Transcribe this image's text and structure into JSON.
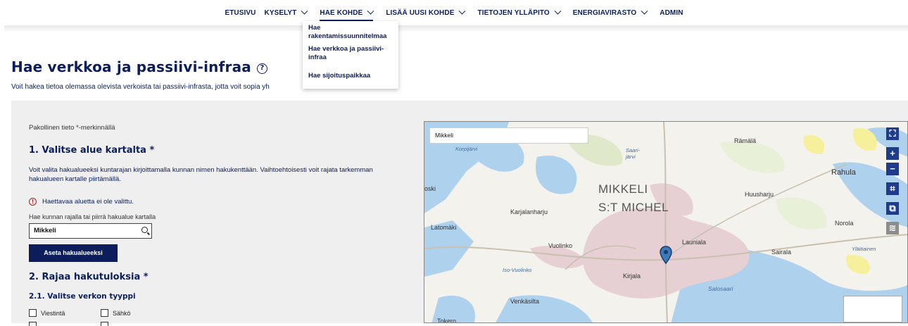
{
  "nav": {
    "items": [
      {
        "label": "ETUSIVU",
        "dropdown": false
      },
      {
        "label": "KYSELYT",
        "dropdown": true
      },
      {
        "label": "HAE KOHDE",
        "dropdown": true,
        "active": true
      },
      {
        "label": "LISÄÄ UUSI KOHDE",
        "dropdown": true
      },
      {
        "label": "TIETOJEN YLLÄPITO",
        "dropdown": true
      },
      {
        "label": "ENERGIAVIRASTO",
        "dropdown": true
      },
      {
        "label": "ADMIN",
        "dropdown": false
      }
    ],
    "dropdown_items": [
      "Hae rakentamissuunnitelmaa",
      "Hae verkkoa ja passiivi-infraa",
      "Hae sijoituspaikkaa"
    ]
  },
  "page": {
    "title": "Hae verkkoa ja passiivi-infraa",
    "help_icon_glyph": "?",
    "subtitle": "Voit hakea tietoa olemassa olevista verkoista tai passiivi-infrasta, jotta voit sopia yh"
  },
  "form": {
    "mandatory_note": "Pakollinen tieto *-merkinnällä",
    "step1_title": "1. Valitse alue kartalta *",
    "step1_desc": "Voit valita hakualueeksi kuntarajan kirjoittamalla kunnan nimen hakukenttään. Vaihtoehtoisesti voit rajata tarkemman hakualueen kartalle piirtämällä.",
    "error_text": "Haettavaa aluetta ei ole valittu.",
    "error_icon_glyph": "!",
    "search_label": "Hae kunnan rajalla tai piirrä hakualue kartalla",
    "search_value": "Mikkeli",
    "set_area_button": "Aseta hakualueeksi",
    "step2_title": "2. Rajaa hakutuloksia *",
    "step21_title": "2.1. Valitse verkon tyyppi",
    "checkboxes": [
      "Viestintä",
      "Sähkö"
    ]
  },
  "map": {
    "search_value": "Mikkeli",
    "controls": [
      "⛶",
      "+",
      "−",
      "⌗",
      "⧉",
      "≋"
    ],
    "labels": {
      "mikkeli": "MIKKELI",
      "stmichel": "S:T MICHEL",
      "ramala": "Rämälä",
      "rahula": "Rahula",
      "huusharju": "Huusharju",
      "karjalanharju": "Karjalanharju",
      "latomaki": "Latomäki",
      "norola": "Norola",
      "vuolinko": "Vuolinko",
      "launiala": "Launiala",
      "sairala": "Sairala",
      "kirjala": "Kirjala",
      "salosaari": "Salosaari",
      "venkasilta": "Venkäsilta",
      "tokero": "Tokero",
      "oski": "oski",
      "korpijarvi": "Korpijärvi",
      "saarijarvi": "Saari-järvi",
      "iso_vuolinko": "Iso-Vuolinko",
      "ylaitiainen": "Yläitiainen"
    }
  }
}
